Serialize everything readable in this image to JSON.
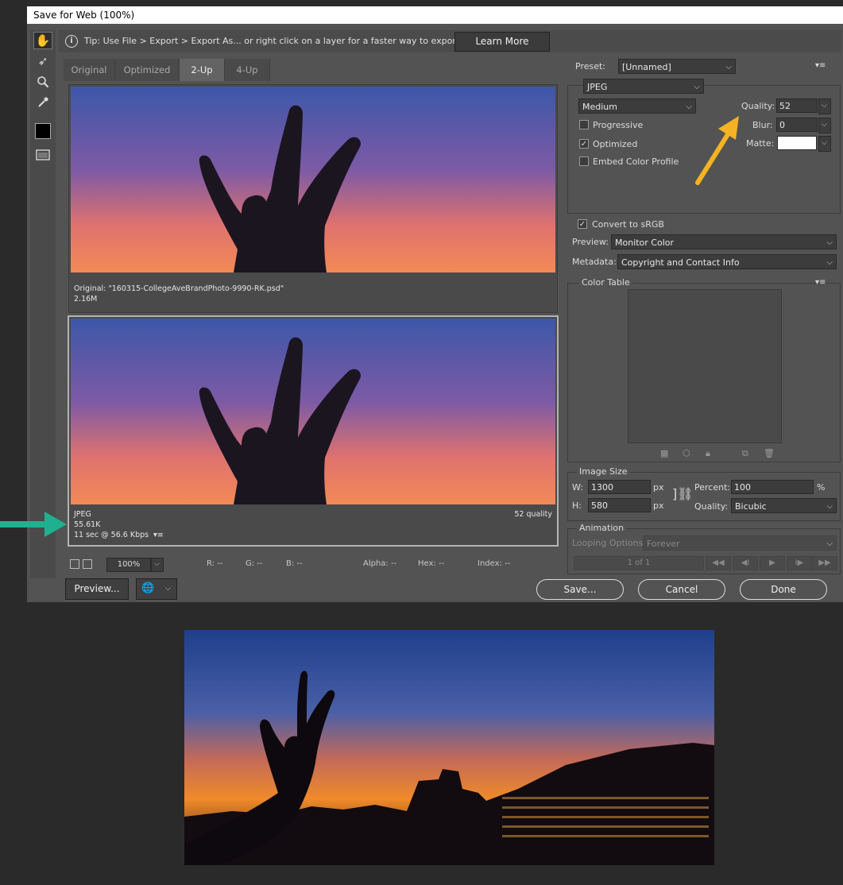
{
  "window": {
    "title": "Save for Web (100%)"
  },
  "tip": {
    "text": "Tip: Use File > Export > Export As...  or right click on a layer for a faster way to export assets",
    "learn_more": "Learn More"
  },
  "tabs": [
    {
      "label": "Original"
    },
    {
      "label": "Optimized"
    },
    {
      "label": "2-Up"
    },
    {
      "label": "4-Up"
    }
  ],
  "original_pane": {
    "filename": "Original: \"160315-CollegeAveBrandPhoto-9990-RK.psd\"",
    "size": "2.16M"
  },
  "optimized_pane": {
    "format": "JPEG",
    "size": "55.61K",
    "download": "11 sec @ 56.6 Kbps",
    "quality": "52 quality"
  },
  "status": {
    "zoom": "100%",
    "r": "R: --",
    "g": "G: --",
    "b": "B: --",
    "alpha": "Alpha: --",
    "hex": "Hex: --",
    "index": "Index: --"
  },
  "buttons": {
    "preview": "Preview...",
    "save": "Save...",
    "cancel": "Cancel",
    "done": "Done"
  },
  "preset": {
    "label": "Preset:",
    "value": "[Unnamed]",
    "format": "JPEG",
    "quality_level": "Medium",
    "quality_label": "Quality:",
    "quality": "52",
    "blur_label": "Blur:",
    "blur": "0",
    "matte_label": "Matte:",
    "matte_color": "#ffffff"
  },
  "options": {
    "progressive": "Progressive",
    "optimized": "Optimized",
    "embed_color": "Embed Color Profile",
    "convert_srgb": "Convert to sRGB"
  },
  "preview_sel": {
    "label": "Preview:",
    "value": "Monitor Color"
  },
  "metadata": {
    "label": "Metadata:",
    "value": "Copyright and Contact Info"
  },
  "color_table": {
    "title": "Color Table"
  },
  "image_size": {
    "title": "Image Size",
    "w_label": "W:",
    "w": "1300",
    "h_label": "H:",
    "h": "580",
    "px": "px",
    "percent_label": "Percent:",
    "percent": "100",
    "pct": "%",
    "quality_label": "Quality:",
    "quality": "Bicubic"
  },
  "animation": {
    "title": "Animation",
    "looping_label": "Looping Options:",
    "looping": "Forever",
    "frame": "1 of 1"
  },
  "colors": {
    "arrow_orange": "#f5b323",
    "arrow_teal": "#1fb08f"
  }
}
